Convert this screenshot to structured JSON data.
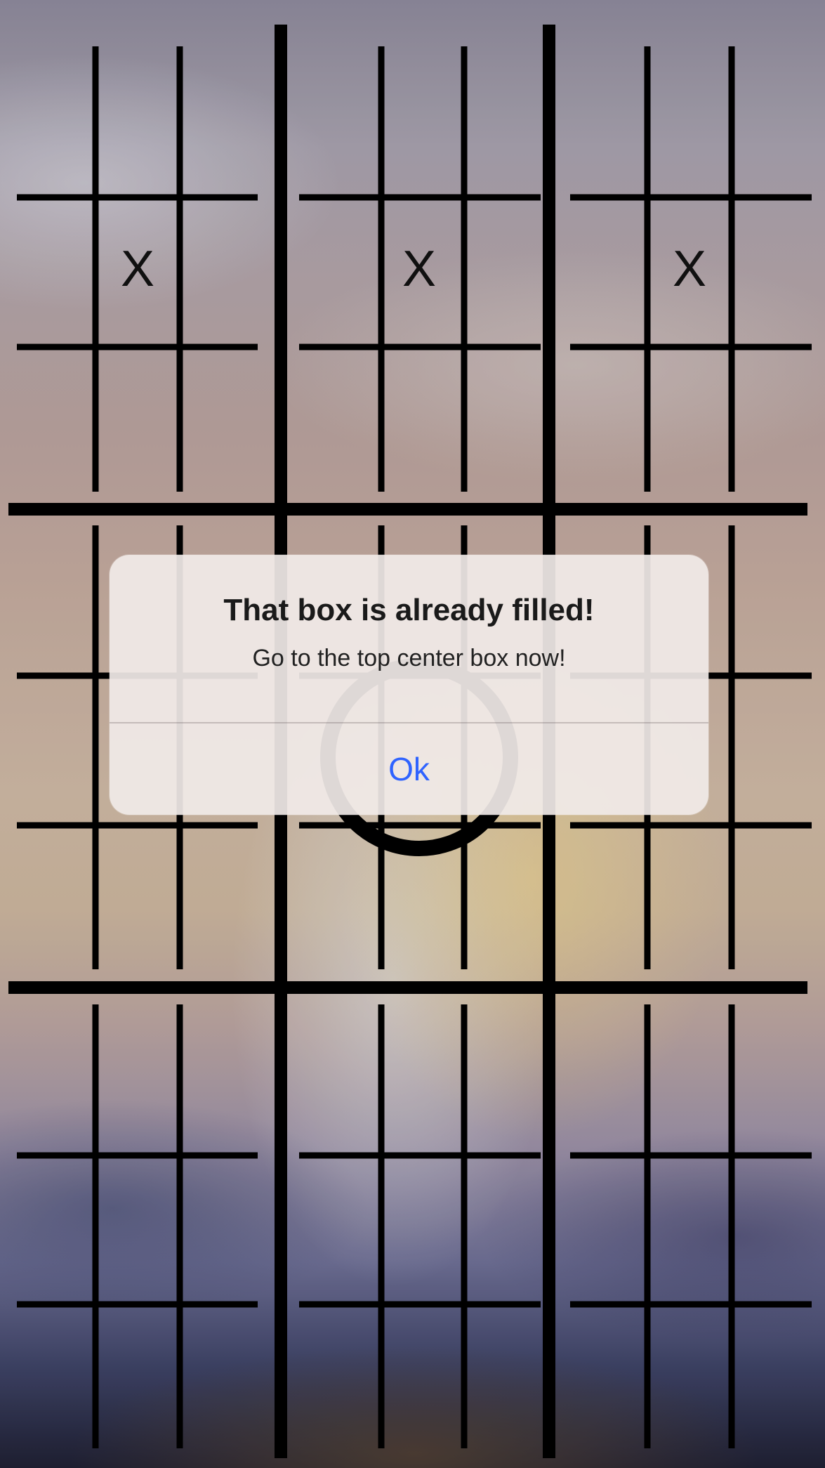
{
  "board": {
    "marks": [
      {
        "symbol": "X",
        "position": "top-left board, center cell"
      },
      {
        "symbol": "X",
        "position": "top-center board, center cell"
      },
      {
        "symbol": "X",
        "position": "top-right board, center cell"
      }
    ]
  },
  "alert": {
    "title": "That box is already filled!",
    "message": "Go to the top center box now!",
    "button_label": "Ok",
    "button_color": "#2f63ff"
  }
}
